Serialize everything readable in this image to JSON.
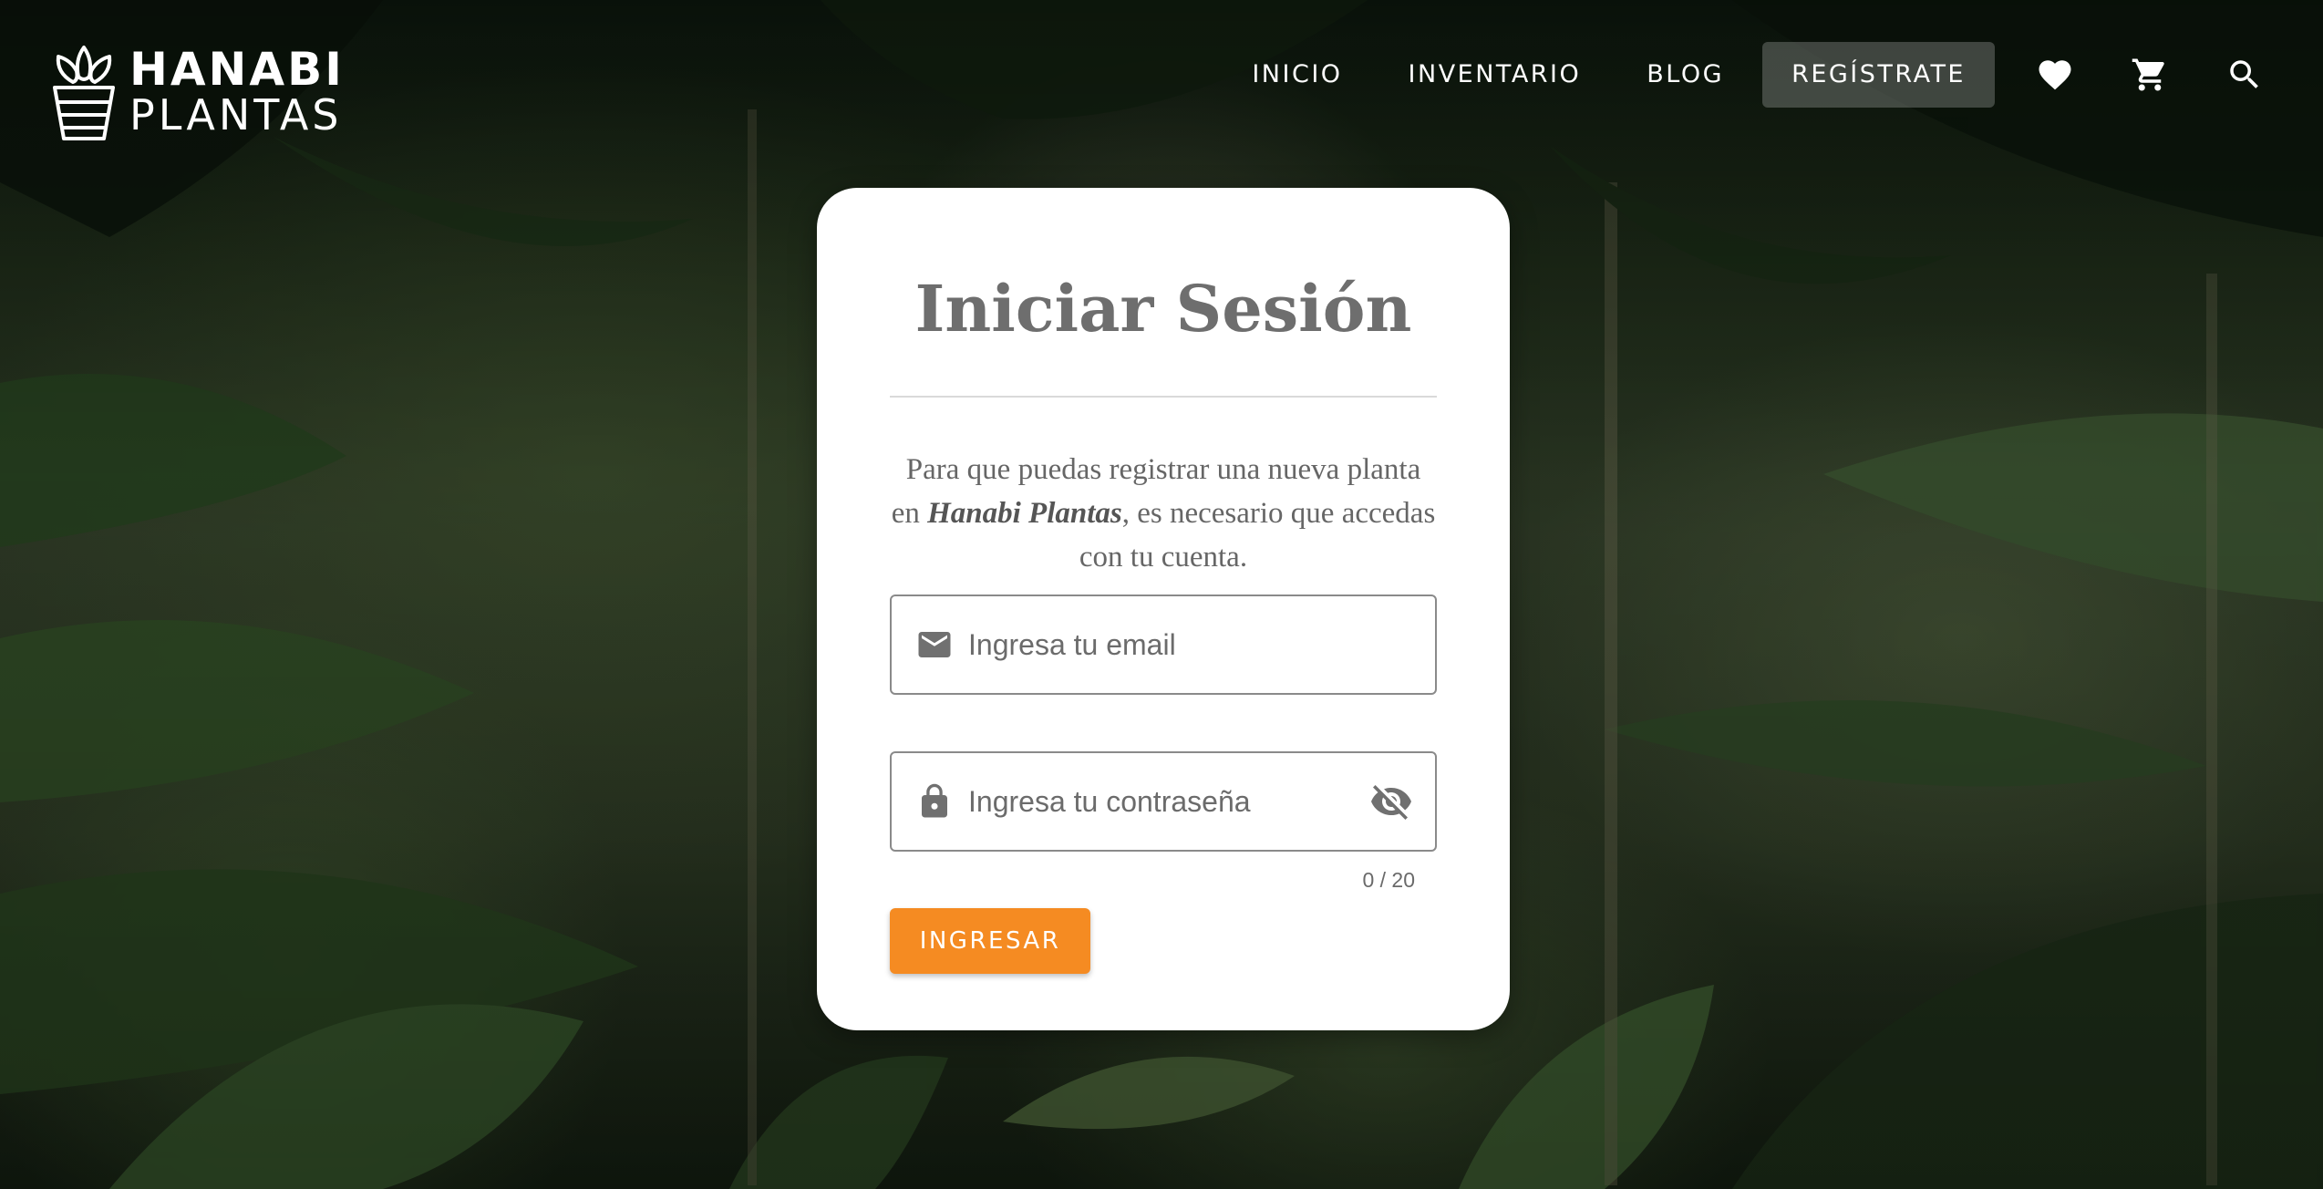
{
  "brand": {
    "line1": "HANABI",
    "line2": "PLANTAS"
  },
  "nav": {
    "items": [
      {
        "label": "INICIO"
      },
      {
        "label": "INVENTARIO"
      },
      {
        "label": "BLOG"
      },
      {
        "label": "REGÍSTRATE",
        "active": true
      }
    ],
    "icons": [
      "heart-icon",
      "cart-icon",
      "search-icon"
    ]
  },
  "login": {
    "title": "Iniciar Sesión",
    "description": {
      "before": "Para que puedas registrar una nueva planta en ",
      "brand": "Hanabi Plantas",
      "after": ", es necesario que accedas con tu cuenta."
    },
    "email_placeholder": "Ingresa tu email",
    "email_value": "",
    "password_placeholder": "Ingresa tu contraseña",
    "password_value": "",
    "password_counter": "0 / 20",
    "submit_label": "INGRESAR"
  },
  "colors": {
    "accent": "#f58b22",
    "card": "#ffffff",
    "title": "#6e6e6e",
    "icon": "#707070"
  }
}
